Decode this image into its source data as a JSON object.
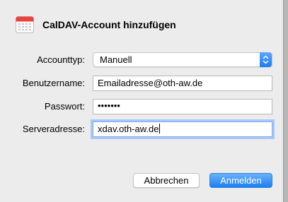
{
  "dialog": {
    "title": "CalDAV-Account hinzufügen",
    "icon": "calendar-icon"
  },
  "form": {
    "account_type": {
      "label": "Accounttyp:",
      "value": "Manuell"
    },
    "username": {
      "label": "Benutzername:",
      "value": "Emailadresse@oth-aw.de"
    },
    "password": {
      "label": "Passwort:",
      "masked_value": "•••••••"
    },
    "server": {
      "label": "Serveradresse:",
      "value": "xdav.oth-aw.de"
    }
  },
  "buttons": {
    "cancel_label": "Abbrechen",
    "ok_label": "Anmelden"
  },
  "colors": {
    "accent": "#1f7bf2",
    "window_bg": "#ececec",
    "focus_ring": "#a9c8f5"
  }
}
